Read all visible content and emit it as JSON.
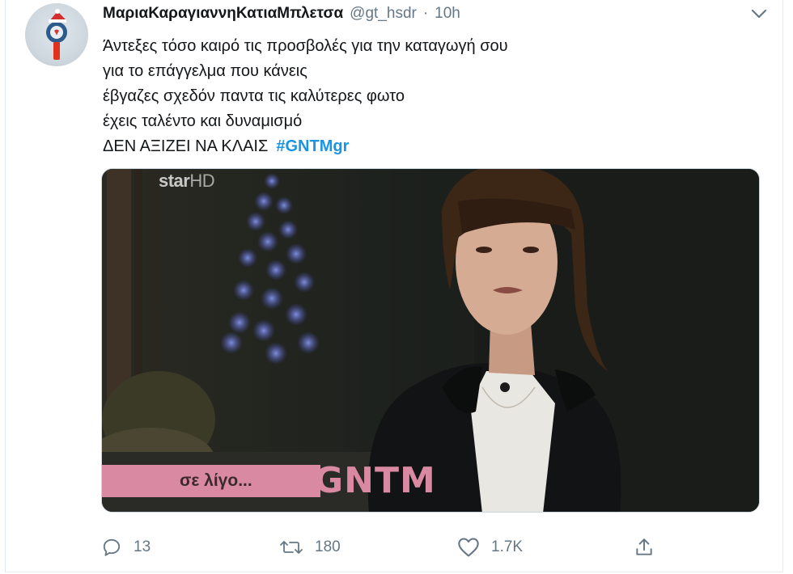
{
  "author": {
    "name": "ΜαριαΚαραγιαννηΚατιαΜπλετσα",
    "handle": "@gt_hsdr",
    "separator": "·",
    "time": "10h"
  },
  "tweet": {
    "lines": [
      "Άντεξες τόσο καιρό τις προσβολές για την καταγωγή σου",
      "για το επάγγελμα που κάνεις",
      "έβγαζες σχεδόν παντα τις καλύτερες φωτο",
      "έχεις ταλέντο και δυναμισμό",
      "ΔΕΝ ΑΞΙΖΕΙ ΝΑ ΚΛΑΙΣ"
    ],
    "hashtag": "#GNTMgr"
  },
  "media": {
    "watermark_main": "star",
    "watermark_hd": "HD",
    "caption": "σε λίγο...",
    "show_logo": "GNTM"
  },
  "actions": {
    "reply_count": "13",
    "retweet_count": "180",
    "like_count": "1.7K"
  },
  "icons": {
    "reply": "reply-icon",
    "retweet": "retweet-icon",
    "like": "heart-icon",
    "share": "share-icon",
    "menu": "chevron-down-icon"
  },
  "colors": {
    "link": "#1b95e0",
    "muted": "#657786",
    "caption_bg": "#d98aa2"
  }
}
